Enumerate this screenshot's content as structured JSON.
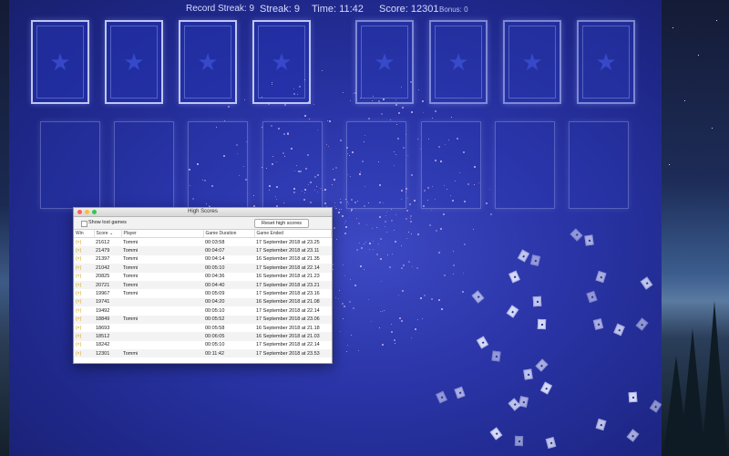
{
  "hud": {
    "record_streak_label": "Record Streak:",
    "record_streak_value": "9",
    "streak_label": "Streak:",
    "streak_value": "9",
    "time_label": "Time:",
    "time_value": "11:42",
    "score_label": "Score:",
    "score_value": "12301",
    "bonus_label": "Bonus:",
    "bonus_value": "0"
  },
  "colors": {
    "board": "#2a34a6",
    "win_badge": "#d49a00"
  },
  "high_scores": {
    "title": "High Scores",
    "show_lost_label": "Show lost games",
    "show_lost_checked": false,
    "reset_label": "Reset high scores",
    "columns": [
      "Win",
      "Score",
      "Player",
      "Game Duration",
      "Game Ended"
    ],
    "sort_indicator": "⌄",
    "win_icon": "(×)",
    "rows": [
      {
        "score": "21612",
        "player": "Tommi",
        "duration": "00:03:58",
        "ended": "17 September 2018 at 23.25"
      },
      {
        "score": "21479",
        "player": "Tommi",
        "duration": "00:04:07",
        "ended": "17 September 2018 at 23.11"
      },
      {
        "score": "21397",
        "player": "Tommi",
        "duration": "00:04:14",
        "ended": "16 September 2018 at 21.35"
      },
      {
        "score": "21042",
        "player": "Tommi",
        "duration": "00:05:10",
        "ended": "17 September 2018 at 22.14"
      },
      {
        "score": "20825",
        "player": "Tommi",
        "duration": "00:04:36",
        "ended": "16 September 2018 at 21.23"
      },
      {
        "score": "20721",
        "player": "Tommi",
        "duration": "00:04:40",
        "ended": "17 September 2018 at 23.21"
      },
      {
        "score": "19967",
        "player": "Tommi",
        "duration": "00:05:09",
        "ended": "17 September 2018 at 23.16"
      },
      {
        "score": "19741",
        "player": "",
        "duration": "00:04:20",
        "ended": "16 September 2018 at 21.08"
      },
      {
        "score": "19492",
        "player": "",
        "duration": "00:05:10",
        "ended": "17 September 2018 at 22.14"
      },
      {
        "score": "18849",
        "player": "Tommi",
        "duration": "00:05:52",
        "ended": "17 September 2018 at 23.06"
      },
      {
        "score": "18693",
        "player": "",
        "duration": "00:05:58",
        "ended": "16 September 2018 at 21.18"
      },
      {
        "score": "18512",
        "player": "",
        "duration": "00:06:05",
        "ended": "16 September 2018 at 21.03"
      },
      {
        "score": "18242",
        "player": "",
        "duration": "00:05:10",
        "ended": "17 September 2018 at 22.14"
      },
      {
        "score": "12301",
        "player": "Tommi",
        "duration": "00:11:42",
        "ended": "17 September 2018 at 23.53"
      }
    ]
  }
}
